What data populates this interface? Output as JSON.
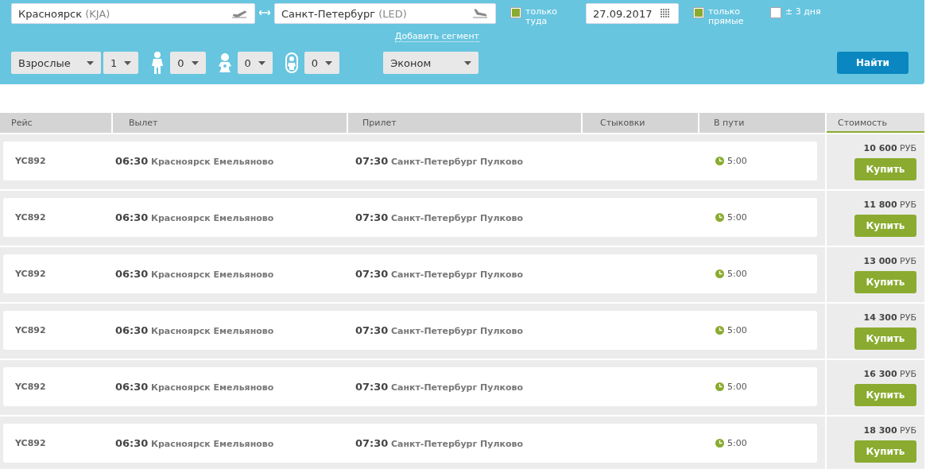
{
  "search": {
    "from": {
      "city": "Красноярск",
      "code": "(KJA)"
    },
    "to": {
      "city": "Санкт-Петербург",
      "code": "(LED)"
    },
    "options": [
      {
        "label": "только туда",
        "checked": true
      },
      {
        "kind": "date",
        "value": "27.09.2017"
      },
      {
        "label": "только прямые",
        "checked": true
      },
      {
        "label": "± 3 дня",
        "checked": false
      }
    ],
    "add_segment": "Добавить сегмент",
    "passengers": [
      {
        "kind": "type",
        "value": "Взрослые"
      },
      {
        "kind": "count",
        "value": "1"
      },
      {
        "kind": "child",
        "value": "0"
      },
      {
        "kind": "baby",
        "value": "0"
      },
      {
        "kind": "infant",
        "value": "0"
      }
    ],
    "class": "Эконом",
    "submit": "Найти"
  },
  "table": {
    "columns": [
      {
        "label": "Рейс",
        "selected": false
      },
      {
        "label": "Вылет",
        "selected": false
      },
      {
        "label": "Прилет",
        "selected": false
      },
      {
        "label": "Стыковки",
        "selected": false
      },
      {
        "label": "В пути",
        "selected": false
      },
      {
        "label": "Стоимость",
        "selected": true
      }
    ],
    "rows": [
      {
        "flight": "YC892",
        "dep_time": "06:30",
        "dep_airport": "Красноярск Емельяново",
        "arr_time": "07:30",
        "arr_airport": "Санкт-Петербург Пулково",
        "duration": "5:00",
        "amount": "10 600",
        "currency": "РУБ",
        "button": "Купить"
      },
      {
        "flight": "YC892",
        "dep_time": "06:30",
        "dep_airport": "Красноярск Емельяново",
        "arr_time": "07:30",
        "arr_airport": "Санкт-Петербург Пулково",
        "duration": "5:00",
        "amount": "11 800",
        "currency": "РУБ",
        "button": "Купить"
      },
      {
        "flight": "YC892",
        "dep_time": "06:30",
        "dep_airport": "Красноярск Емельяново",
        "arr_time": "07:30",
        "arr_airport": "Санкт-Петербург Пулково",
        "duration": "5:00",
        "amount": "13 000",
        "currency": "РУБ",
        "button": "Купить"
      },
      {
        "flight": "YC892",
        "dep_time": "06:30",
        "dep_airport": "Красноярск Емельяново",
        "arr_time": "07:30",
        "arr_airport": "Санкт-Петербург Пулково",
        "duration": "5:00",
        "amount": "14 300",
        "currency": "РУБ",
        "button": "Купить"
      },
      {
        "flight": "YC892",
        "dep_time": "06:30",
        "dep_airport": "Красноярск Емельяново",
        "arr_time": "07:30",
        "arr_airport": "Санкт-Петербург Пулково",
        "duration": "5:00",
        "amount": "16 300",
        "currency": "РУБ",
        "button": "Купить"
      },
      {
        "flight": "YC892",
        "dep_time": "06:30",
        "dep_airport": "Красноярск Емельяново",
        "arr_time": "07:30",
        "arr_airport": "Санкт-Петербург Пулково",
        "duration": "5:00",
        "amount": "18 300",
        "currency": "РУБ",
        "button": "Купить"
      }
    ]
  }
}
